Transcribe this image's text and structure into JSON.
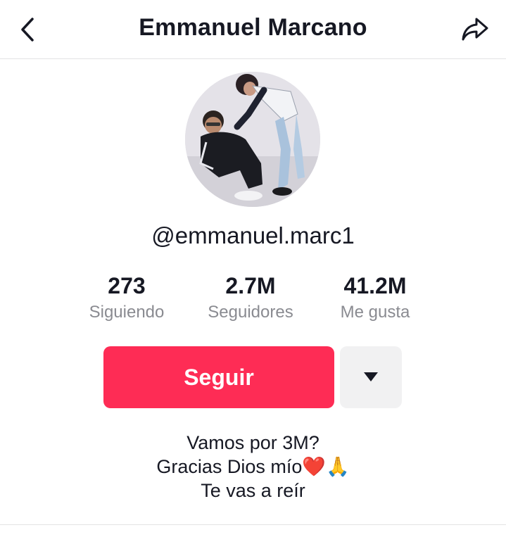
{
  "header": {
    "title": "Emmanuel Marcano",
    "back_icon": "chevron-left-icon",
    "share_icon": "share-arrow-icon"
  },
  "profile": {
    "avatar_icon": "profile-photo",
    "username": "@emmanuel.marc1"
  },
  "stats": [
    {
      "value": "273",
      "label": "Siguiendo"
    },
    {
      "value": "2.7M",
      "label": "Seguidores"
    },
    {
      "value": "41.2M",
      "label": "Me gusta"
    }
  ],
  "actions": {
    "follow_label": "Seguir",
    "more_icon": "caret-down-icon",
    "accent_color": "#fe2c55"
  },
  "bio": {
    "lines": [
      "Vamos por 3M?",
      "Gracias Dios mío❤️🙏",
      "Te vas a reír"
    ]
  }
}
